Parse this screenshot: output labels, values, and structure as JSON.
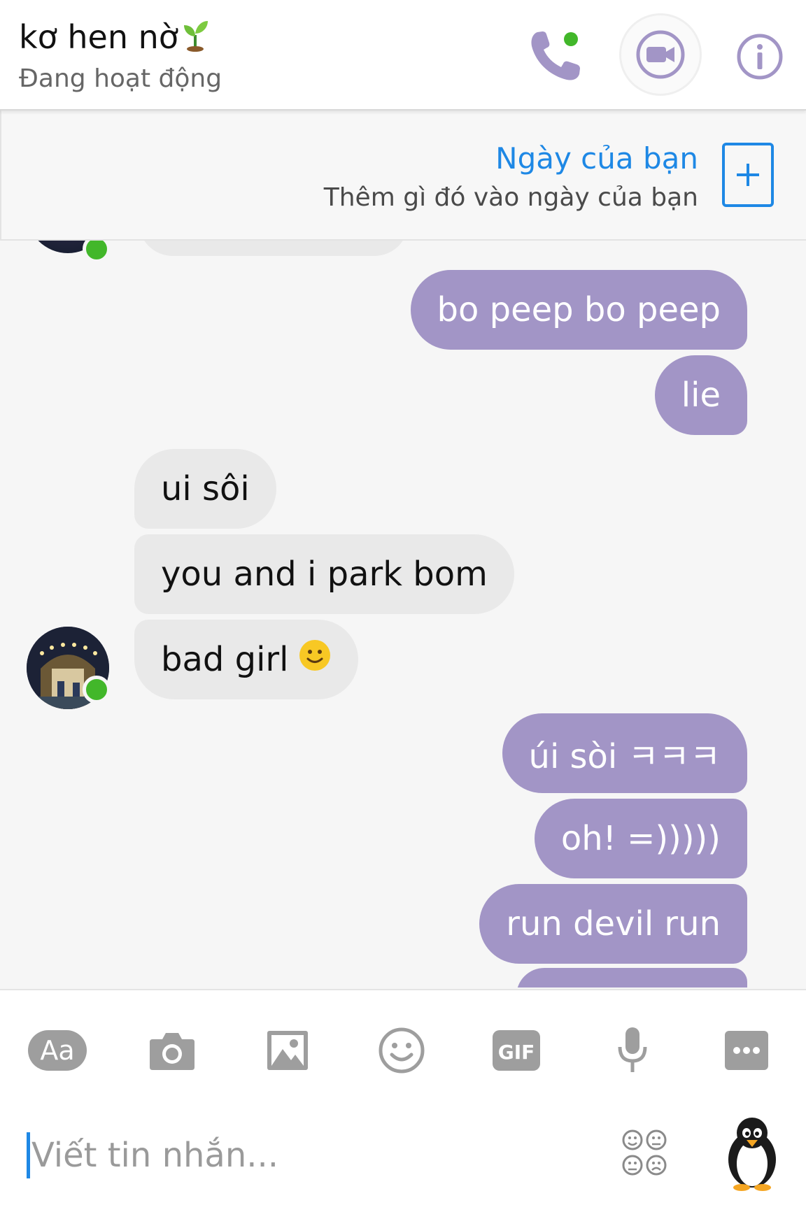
{
  "header": {
    "title": "kơ hen nờ",
    "title_emoji_icon": "seedling-icon",
    "status": "Đang hoạt động",
    "status_color": "#42b72a",
    "accent_color": "#a295c6",
    "icons": [
      "phone-icon",
      "video-camera-icon",
      "info-icon"
    ]
  },
  "story": {
    "title": "Ngày của bạn",
    "subtitle": "Thêm gì đó vào ngày của bạn",
    "add_icon": "plus-icon",
    "link_color": "#1e88e5"
  },
  "messages": [
    {
      "side": "out",
      "text": "bo peep bo peep"
    },
    {
      "side": "out",
      "text": "lie"
    },
    {
      "side": "in",
      "text": "ui sôi"
    },
    {
      "side": "in",
      "text": "you and i park bom"
    },
    {
      "side": "in",
      "text": "bad girl",
      "emoji": "slightly-smiling-face-icon"
    },
    {
      "side": "out",
      "text": "úi sòi ㅋㅋㅋ"
    },
    {
      "side": "out",
      "text": "oh! =)))))"
    },
    {
      "side": "out",
      "text": "run devil run"
    }
  ],
  "composer": {
    "aa_label": "Aa",
    "gif_label": "GIF",
    "placeholder": "Viết tin nhắn...",
    "tools": [
      "text-style-icon",
      "camera-icon",
      "image-icon",
      "emoji-icon",
      "gif-icon",
      "microphone-icon",
      "more-icon"
    ],
    "sticker_icon": "stickers-icon",
    "penguin_icon": "penguin-sticker-icon"
  }
}
